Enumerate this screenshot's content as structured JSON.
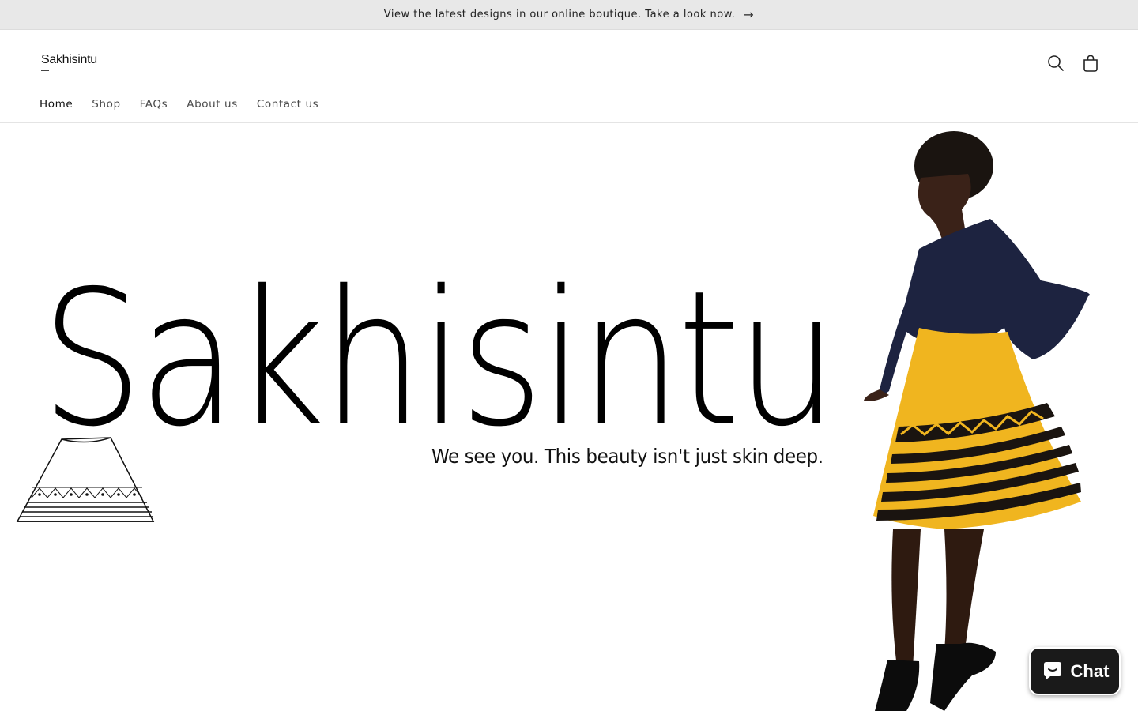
{
  "announcement": {
    "text": "View the latest designs in our online boutique. Take a look now.",
    "arrow": "→"
  },
  "header": {
    "logo_text": "Sakhisintu",
    "icons": {
      "search": "search-icon",
      "cart": "cart-icon"
    }
  },
  "nav": {
    "items": [
      {
        "label": "Home",
        "active": true
      },
      {
        "label": "Shop"
      },
      {
        "label": "FAQs"
      },
      {
        "label": "About us"
      },
      {
        "label": "Contact us"
      }
    ]
  },
  "hero": {
    "title": "Sakhisintu",
    "tagline": "We see you. This beauty isn't just skin deep."
  },
  "chat": {
    "label": "Chat",
    "icon": "chat-bubble-icon"
  },
  "colors": {
    "announcement_bg": "#e8e8e8",
    "chat_bg": "#1a1a1a",
    "skirt_yellow": "#f0b51f",
    "top_navy": "#1d2340"
  }
}
